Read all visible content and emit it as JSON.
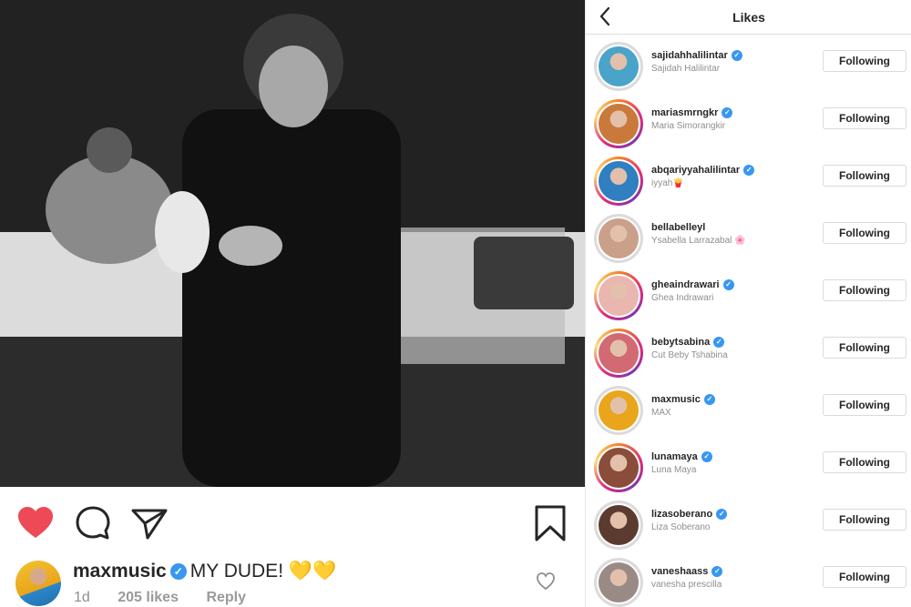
{
  "post": {
    "username": "maxmusic",
    "caption": "MY DUDE! 💛💛",
    "time": "1d",
    "likes": "205 likes",
    "reply": "Reply"
  },
  "likes_panel": {
    "title": "Likes",
    "button_label": "Following",
    "users": [
      {
        "username": "sajidahhalilintar",
        "name": "Sajidah Halilintar",
        "verified": true,
        "story": false,
        "color": "#4aa3c9"
      },
      {
        "username": "mariasmrngkr",
        "name": "Maria Simorangkir",
        "verified": true,
        "story": true,
        "color": "#c9793a"
      },
      {
        "username": "abqariyyahalilintar",
        "name": "iyyah🍟",
        "verified": true,
        "story": true,
        "color": "#2f7fc1"
      },
      {
        "username": "bellabelleyl",
        "name": "Ysabella Larrazabal 🌸",
        "verified": false,
        "story": false,
        "color": "#caa08a"
      },
      {
        "username": "gheaindrawari",
        "name": "Ghea Indrawari",
        "verified": true,
        "story": true,
        "color": "#e9b6b0"
      },
      {
        "username": "bebytsabina",
        "name": "Cut Beby Tshabina",
        "verified": true,
        "story": true,
        "color": "#d16a72"
      },
      {
        "username": "maxmusic",
        "name": "MAX",
        "verified": true,
        "story": false,
        "color": "#e9a51c"
      },
      {
        "username": "lunamaya",
        "name": "Luna Maya",
        "verified": true,
        "story": true,
        "color": "#8a4d3a"
      },
      {
        "username": "lizasoberano",
        "name": "Liza Soberano",
        "verified": true,
        "story": false,
        "color": "#5b3b30"
      },
      {
        "username": "vaneshaass",
        "name": "vanesha prescilla",
        "verified": true,
        "story": false,
        "color": "#9a8a86"
      }
    ]
  }
}
